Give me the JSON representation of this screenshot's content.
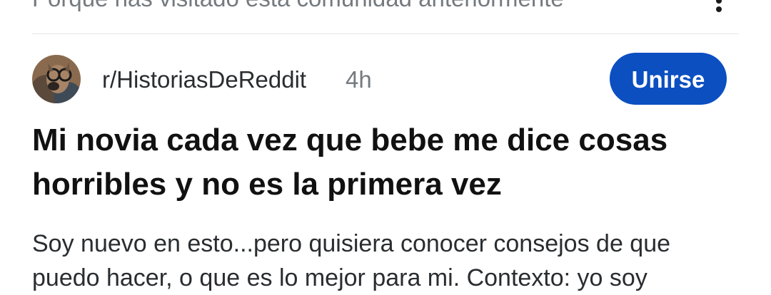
{
  "recommendation": {
    "reason_text": "Porque has visitado esta comunidad anteriormente"
  },
  "post": {
    "subreddit": "r/HistoriasDeReddit",
    "age": "4h",
    "join_label": "Unirse",
    "title": "Mi novia cada vez que bebe me dice cosas horribles y no es la primera vez",
    "body": "Soy nuevo en esto...pero quisiera conocer consejos de que puedo hacer, o que es lo mejor para mi. Contexto: yo soy"
  },
  "icons": {
    "more": "more-vertical-icon",
    "avatar": "subreddit-avatar-icon"
  },
  "colors": {
    "join_button": "#0b4fc1",
    "secondary_text": "#747a80",
    "title_text": "#111111"
  }
}
